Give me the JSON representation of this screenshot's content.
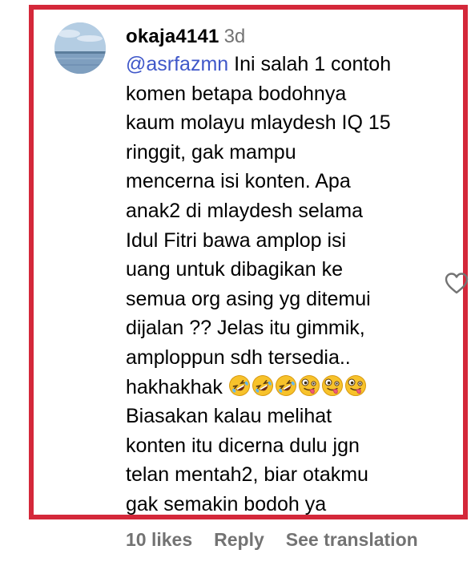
{
  "comment": {
    "username": "okaja4141",
    "timestamp": "3d",
    "mention": "@asrfazmn",
    "text_lines": [
      " Ini salah 1 contoh",
      "komen betapa bodohnya",
      "kaum molayu mlaydesh IQ 15",
      "ringgit, gak mampu",
      "mencerna isi konten. Apa",
      "anak2 di mlaydesh selama",
      "Idul Fitri bawa amplop isi",
      "uang untuk dibagikan ke",
      "semua org asing yg ditemui",
      "dijalan ?? Jelas itu gimmik,",
      "amploppun sdh tersedia..",
      "hakhakhak ",
      "Biasakan kalau melihat",
      "konten itu dicerna dulu jgn",
      "telan mentah2, biar otakmu",
      "gak semakin bodoh ya"
    ],
    "emojis": [
      "rolling-on-floor-laughing",
      "rolling-on-floor-laughing",
      "rolling-on-floor-laughing",
      "zany-face",
      "zany-face",
      "zany-face"
    ]
  },
  "actions": {
    "likes": "10 likes",
    "reply": "Reply",
    "see_translation": "See translation"
  },
  "icons": {
    "like": "heart-outline-icon"
  },
  "colors": {
    "highlight_border": "#d4283a",
    "mention": "#3f57c9",
    "muted": "#737373"
  }
}
